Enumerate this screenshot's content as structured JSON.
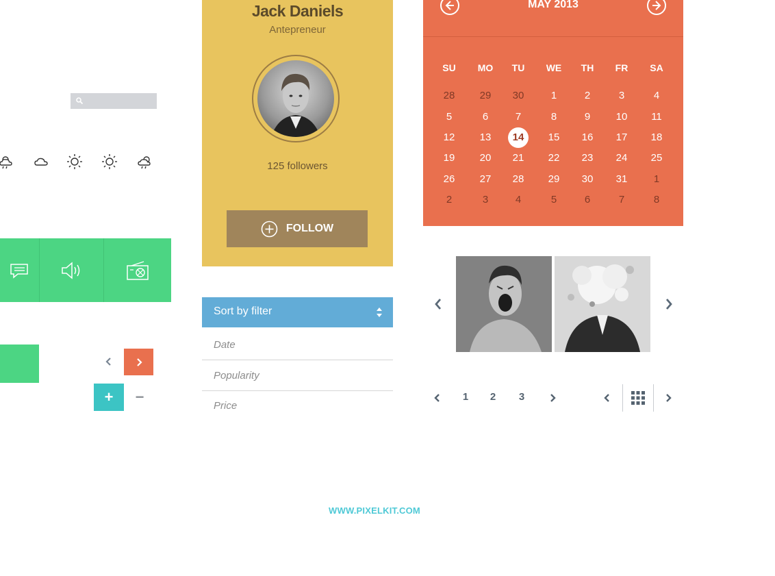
{
  "search": {
    "placeholder": ""
  },
  "weather": {
    "icons": [
      "cloud-sun-rain-icon",
      "cloud-icon",
      "sun-icon",
      "sun-icon",
      "cloud-sun-rain-icon"
    ]
  },
  "tiles": {
    "icons": [
      "chat-icon",
      "speaker-icon",
      "radio-icon"
    ]
  },
  "profile": {
    "name": "Jack Daniels",
    "title": "Antepreneur",
    "followers": "125 followers",
    "follow_label": "FOLLOW"
  },
  "sort": {
    "label": "Sort by filter",
    "options": [
      "Date",
      "Popularity",
      "Price"
    ]
  },
  "calendar": {
    "title": "MAY 2013",
    "weekdays": [
      "SU",
      "MO",
      "TU",
      "WE",
      "TH",
      "FR",
      "SA"
    ],
    "today": "14",
    "weeks": [
      [
        "28",
        "29",
        "30",
        "1",
        "2",
        "3",
        "4"
      ],
      [
        "5",
        "6",
        "7",
        "8",
        "9",
        "10",
        "11"
      ],
      [
        "12",
        "13",
        "14",
        "15",
        "16",
        "17",
        "18"
      ],
      [
        "19",
        "20",
        "21",
        "22",
        "23",
        "24",
        "25"
      ],
      [
        "26",
        "27",
        "28",
        "29",
        "30",
        "31",
        "1"
      ],
      [
        "2",
        "3",
        "4",
        "5",
        "6",
        "7",
        "8"
      ]
    ]
  },
  "pagination": {
    "pages": [
      "1",
      "2",
      "3"
    ]
  },
  "footer": {
    "link": "WWW.PIXELKIT.COM"
  },
  "colors": {
    "green": "#4cd583",
    "orange": "#e9704e",
    "yellow": "#e8c45e",
    "blue": "#62acd7",
    "teal": "#3cc4c4"
  }
}
